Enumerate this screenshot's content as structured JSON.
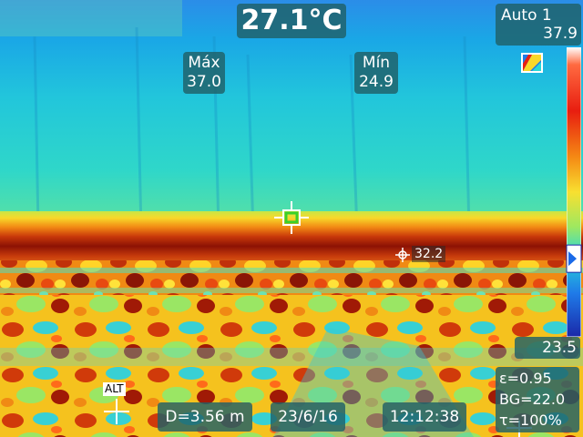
{
  "center_temp": "27.1°C",
  "max": {
    "label": "Máx",
    "value": "37.0"
  },
  "min": {
    "label": "Mín",
    "value": "24.9"
  },
  "range": {
    "mode": "Auto 1",
    "max": "37.9",
    "min": "23.5",
    "level_fraction": 0.73
  },
  "spot": {
    "value": "32.2"
  },
  "alt_label": "ALT",
  "distance": "D=3.56 m",
  "date": "23/6/16",
  "time": "12:12:38",
  "params": {
    "emissivity": "ε=0.95",
    "background": "BG=22.0",
    "transmission": "τ=100%"
  },
  "icons": [
    "center-crosshair-icon",
    "spot-marker-icon",
    "alt-crosshair-icon",
    "palette-icon",
    "level-pointer-icon"
  ]
}
